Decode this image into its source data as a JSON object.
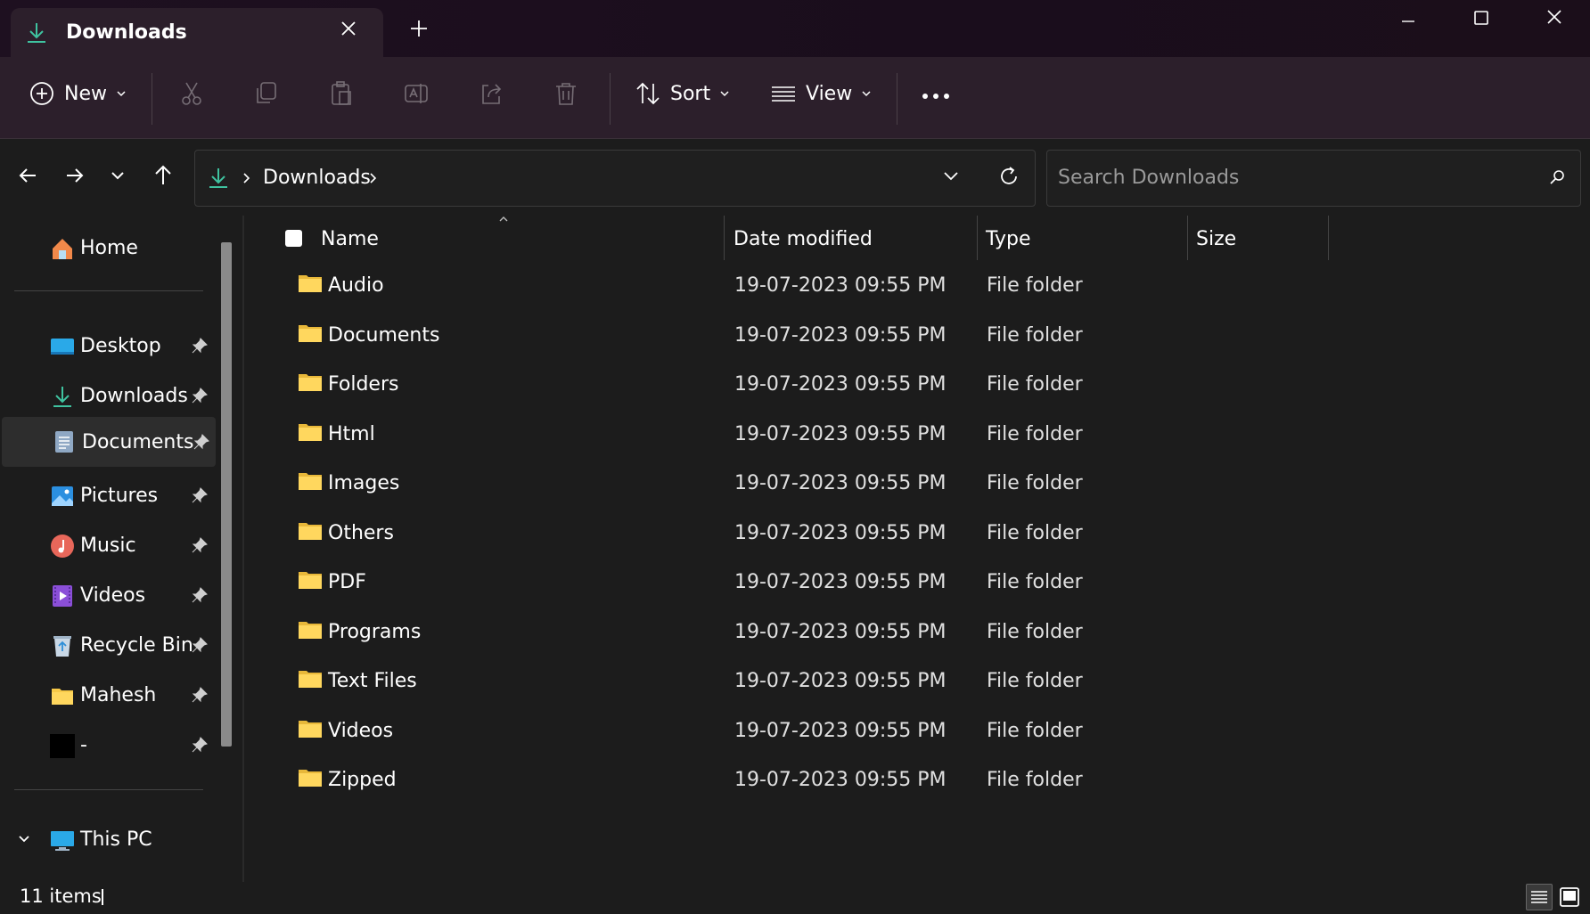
{
  "window": {
    "tab_title": "Downloads",
    "tab_icon": "download-arrow-icon",
    "controls": [
      "minimize-icon",
      "maximize-icon",
      "close-icon"
    ]
  },
  "toolbar": {
    "new_label": "New",
    "sort_label": "Sort",
    "view_label": "View",
    "icons": [
      "cut-icon",
      "copy-icon",
      "paste-icon",
      "rename-icon",
      "share-icon",
      "delete-icon",
      "more-icon"
    ]
  },
  "address": {
    "crumb": "Downloads",
    "search_placeholder": "Search Downloads"
  },
  "sidebar": {
    "home": "Home",
    "items": [
      {
        "label": "Desktop",
        "icon": "desktop-icon"
      },
      {
        "label": "Downloads",
        "icon": "download-arrow-icon"
      },
      {
        "label": "Documents",
        "icon": "documents-icon"
      },
      {
        "label": "Pictures",
        "icon": "pictures-icon"
      },
      {
        "label": "Music",
        "icon": "music-icon"
      },
      {
        "label": "Videos",
        "icon": "videos-icon"
      },
      {
        "label": "Recycle Bin",
        "icon": "recycle-bin-icon"
      },
      {
        "label": "Mahesh",
        "icon": "folder-icon"
      },
      {
        "label": "-",
        "icon": "black-square-icon"
      }
    ],
    "this_pc": "This PC"
  },
  "columns": {
    "name": "Name",
    "date": "Date modified",
    "type": "Type",
    "size": "Size"
  },
  "files": [
    {
      "name": "Audio",
      "date": "19-07-2023 09:55 PM",
      "type": "File folder"
    },
    {
      "name": "Documents",
      "date": "19-07-2023 09:55 PM",
      "type": "File folder"
    },
    {
      "name": "Folders",
      "date": "19-07-2023 09:55 PM",
      "type": "File folder"
    },
    {
      "name": "Html",
      "date": "19-07-2023 09:55 PM",
      "type": "File folder"
    },
    {
      "name": "Images",
      "date": "19-07-2023 09:55 PM",
      "type": "File folder"
    },
    {
      "name": "Others",
      "date": "19-07-2023 09:55 PM",
      "type": "File folder"
    },
    {
      "name": "PDF",
      "date": "19-07-2023 09:55 PM",
      "type": "File folder"
    },
    {
      "name": "Programs",
      "date": "19-07-2023 09:55 PM",
      "type": "File folder"
    },
    {
      "name": "Text Files",
      "date": "19-07-2023 09:55 PM",
      "type": "File folder"
    },
    {
      "name": "Videos",
      "date": "19-07-2023 09:55 PM",
      "type": "File folder"
    },
    {
      "name": "Zipped",
      "date": "19-07-2023 09:55 PM",
      "type": "File folder"
    }
  ],
  "status": {
    "count": "11 items"
  },
  "colors": {
    "accent_download": "#3fc3a0",
    "folder": "#f7c948",
    "toolbar_bg": "#2c1f2b"
  }
}
